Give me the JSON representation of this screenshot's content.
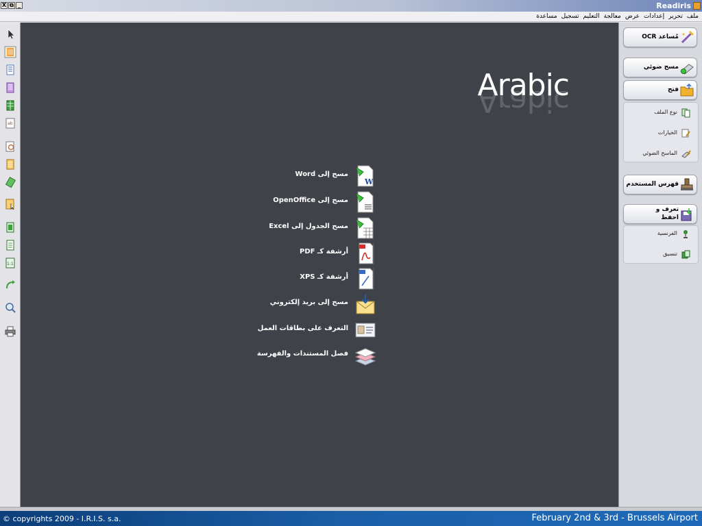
{
  "titlebar": {
    "app_title": "Readiris",
    "controls": [
      "X",
      "⧉",
      "_"
    ]
  },
  "menu": {
    "items": [
      "ملف",
      "تحرير",
      "إعدادات",
      "عرض",
      "معالجة",
      "التعليم",
      "تسجيل",
      "مساعدة"
    ]
  },
  "workspace": {
    "language_title": "Arabic",
    "actions": [
      {
        "label": "مسح إلى Word",
        "icon": "word-document-icon"
      },
      {
        "label": "مسح إلى OpenOffice",
        "icon": "openoffice-document-icon"
      },
      {
        "label": "مسح الجدول إلى Excel",
        "icon": "excel-spreadsheet-icon"
      },
      {
        "label": "أرشفة كـ PDF",
        "icon": "pdf-archive-icon"
      },
      {
        "label": "أرشفة كـ XPS",
        "icon": "xps-archive-icon"
      },
      {
        "label": "مسح إلى بريد إلكتروني",
        "icon": "email-envelope-icon"
      },
      {
        "label": "التعرف على بطاقات العمل",
        "icon": "business-card-icon"
      },
      {
        "label": "فصل المستندات والفهرسة",
        "icon": "document-stack-icon"
      }
    ]
  },
  "rightpanel": {
    "ocr_wizard": "مُساعد OCR",
    "scan": "مسح ضوئي",
    "open": "فتح",
    "group1": [
      "نوع الملف",
      "الخيارات",
      "الماسح الضوئي"
    ],
    "user_dictionary": "قهرس المستخدم",
    "recognize_save": [
      "تعرف و",
      "احفظ"
    ],
    "group2": [
      "الفرنسية",
      "تنسيق"
    ]
  },
  "footer": {
    "copyright": "© copyrights 2009 - I.R.I.S. s.a.",
    "event": "February 2nd & 3rd - Brussels Airport"
  },
  "colors": {
    "workspace_bg": "#404249",
    "footer_blue": "#1a5fa8"
  }
}
